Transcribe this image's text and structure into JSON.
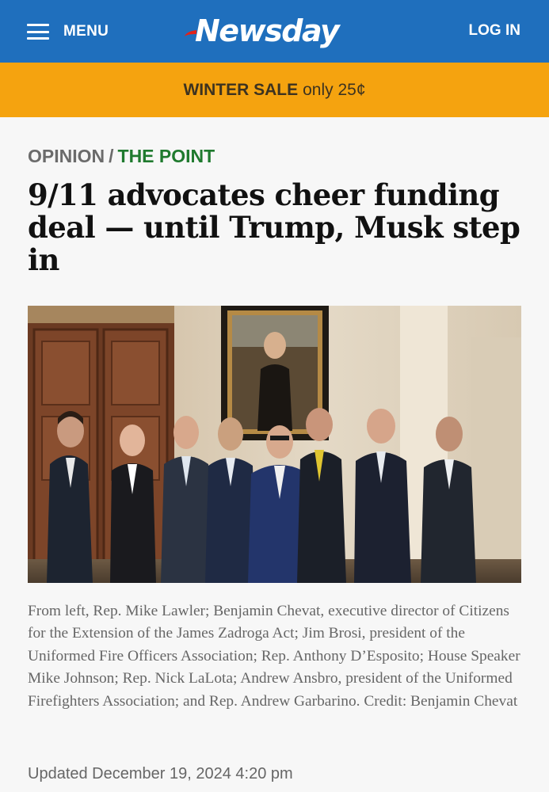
{
  "header": {
    "menu_label": "MENU",
    "logo_text": "Newsday",
    "login_label": "LOG IN",
    "bg_color": "#1f6fbd"
  },
  "promo": {
    "strong": "WINTER SALE",
    "rest": "only 25¢",
    "bg_color": "#f5a30f"
  },
  "article": {
    "section": "OPINION",
    "separator": "/",
    "subsection": "THE POINT",
    "headline": "9/11 advocates cheer funding deal — until Trump, Musk step in",
    "caption": "From left, Rep. Mike Lawler; Benjamin Chevat, executive director of Citizens for the Extension of the James Zadroga Act; Jim Brosi, president of the Uniformed Fire Officers Association; Rep. Anthony D’Esposito; House Speaker Mike Johnson; Rep. Nick LaLota; Andrew Ansbro, president of the Uniformed Firefighters Association; and Rep. Andrew Garbarino. Credit: Benjamin Chevat",
    "updated": "Updated December 19, 2024 4:20 pm",
    "section_color": "#6b6b6b",
    "subsection_color": "#1f7a2e"
  },
  "icons": {
    "menu": "hamburger-icon"
  }
}
